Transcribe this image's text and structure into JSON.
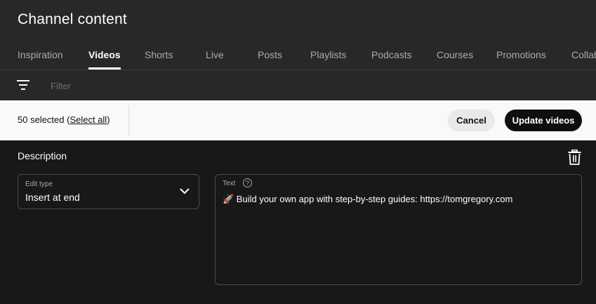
{
  "header": {
    "title": "Channel content"
  },
  "tabs": [
    {
      "label": "Inspiration",
      "active": false
    },
    {
      "label": "Videos",
      "active": true
    },
    {
      "label": "Shorts",
      "active": false
    },
    {
      "label": "Live",
      "active": false
    },
    {
      "label": "Posts",
      "active": false
    },
    {
      "label": "Playlists",
      "active": false
    },
    {
      "label": "Podcasts",
      "active": false
    },
    {
      "label": "Courses",
      "active": false
    },
    {
      "label": "Promotions",
      "active": false
    },
    {
      "label": "Collab",
      "active": false
    }
  ],
  "filter": {
    "icon": "filter-icon",
    "placeholder": "Filter"
  },
  "selection": {
    "count_text": "50 selected (",
    "select_all": "Select all",
    "close_paren": ")",
    "cancel": "Cancel",
    "update": "Update videos"
  },
  "description": {
    "heading": "Description",
    "trash_icon": "trash-icon",
    "edit_type": {
      "label": "Edit type",
      "value": "Insert at end"
    },
    "text": {
      "label": "Text",
      "help": "?",
      "value": "🚀 Build your own app with step-by-step guides:  https://tomgregory.com"
    }
  }
}
